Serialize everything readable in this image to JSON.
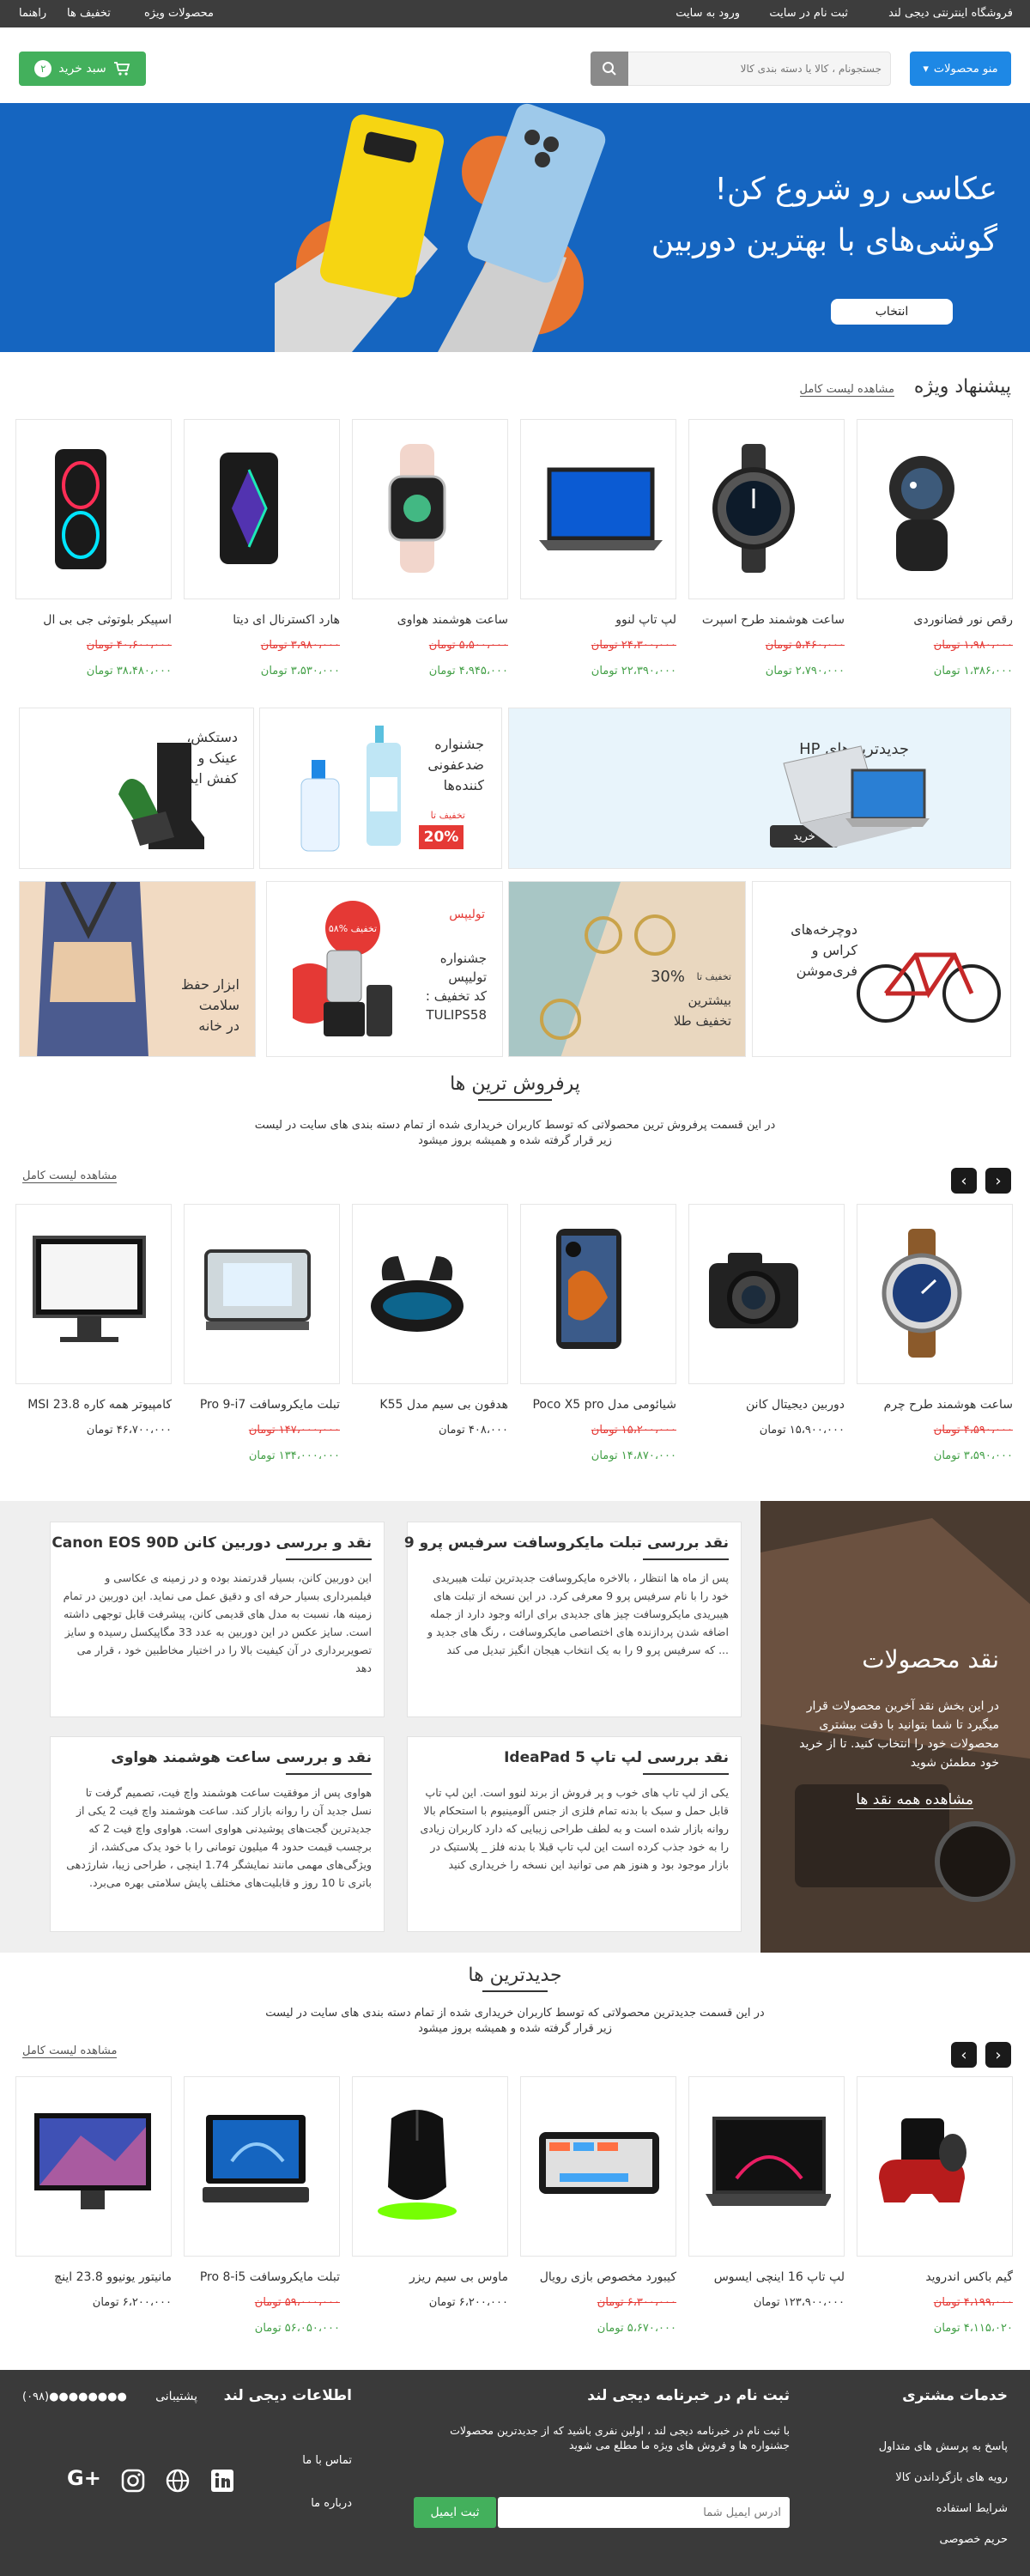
{
  "topbar": {
    "store_name": "فروشگاه اینترنتی دیجی لند",
    "register": "ثبت نام در سایت",
    "login": "ورود به سایت",
    "special": "محصولات ویژه",
    "discounts": "تخفیف ها",
    "help": "راهنما"
  },
  "header": {
    "menu_label": "منو محصولات",
    "search_placeholder": "جستجونام ، کالا یا دسته بندی کالا",
    "cart_label": "سبد خرید",
    "cart_count": "۲"
  },
  "hero": {
    "line1": "عکاسی رو شروع کن!",
    "line2": "گوشی‌های با بهترین دوربین",
    "button": "انتخاب"
  },
  "special": {
    "title": "پیشنهاد ویژه",
    "see_all": "مشاهده لیست کامل",
    "products": [
      {
        "name": "رقص نور فضانوردی",
        "old": "۱،۹۸۰،۰۰۰ تومان",
        "price": "۱،۳۸۶،۰۰۰ تومان",
        "icon": "astronaut-lamp-icon"
      },
      {
        "name": "ساعت هوشمند طرح اسپرت",
        "old": "۵،۴۶۰،۰۰۰ تومان",
        "price": "۲،۷۹۰،۰۰۰ تومان",
        "icon": "sport-smartwatch-icon"
      },
      {
        "name": "لپ تاپ لنوو",
        "old": "۲۴،۳۰۰،۰۰۰ تومان",
        "price": "۲۲،۳۹۰،۰۰۰ تومان",
        "icon": "laptop-icon"
      },
      {
        "name": "ساعت هوشمند هواوی",
        "old": "۵،۵۰۰،۰۰۰ تومان",
        "price": "۴،۹۴۵،۰۰۰ تومان",
        "icon": "huawei-watch-icon"
      },
      {
        "name": "هارد اکسترنال ای دیتا",
        "old": "۳،۹۸۰،۰۰۰ تومان",
        "price": "۳،۵۳۰،۰۰۰ تومان",
        "icon": "external-hdd-icon"
      },
      {
        "name": "اسپیکر بلوتوثی جی بی ال",
        "old": "۴۰،۶۰۰،۰۰۰ تومان",
        "price": "۳۸،۴۸۰،۰۰۰ تومان",
        "icon": "speaker-icon"
      }
    ]
  },
  "banners": {
    "hp": "جدیدترین‌های HP",
    "hp_btn": "خرید",
    "disinfect": "جشنواره\nضدعفونی\nکننده‌ها",
    "disinfect_tag": "تخفیف تا",
    "disinfect_pct": "20%",
    "safety": "دستکش،\nعینک و\nکفش ایمنی",
    "bike": "دوچرخه‌های\nکراس و\nفری‌موشن",
    "gold_small": "تخفیف تا",
    "gold_pct": "30%",
    "gold_text": "بیشترین\nتخفیف طلا",
    "tulips_brand": "تولیپس",
    "tulips_text": "جشنواره\nتولیپس\nکد تخفیف :\nTULIPS58",
    "tulips_sticker": "۵۸% تخفیف",
    "health": "ابزار حفظ\nسلامت\nدر خانه"
  },
  "bestsellers": {
    "title": "پرفروش ترین ها",
    "desc1": "در این قسمت پرفروش ترین محصولاتی که توسط کاربران خریداری شده از تمام دسته بندی های سایت در لیست",
    "desc2": "زیر قرار گرفته شده و همیشه بروز میشود",
    "see_all": "مشاهده لیست کامل",
    "prev": "‹",
    "next": "›",
    "products": [
      {
        "name": "ساعت هوشمند طرح چرم",
        "old": "۴،۵۹۰،۰۰۰ تومان",
        "price": "۳،۵۹۰،۰۰۰ تومان",
        "icon": "leather-watch-icon"
      },
      {
        "name": "دوربین دیجیتال کانن",
        "old": "",
        "price": "۱۵،۹۰۰،۰۰۰ تومان",
        "icon": "camera-icon"
      },
      {
        "name": "شیائومی مدل Poco X5 pro",
        "old": "۱۵،۲۰۰،۰۰۰ تومان",
        "price": "۱۴،۸۷۰،۰۰۰ تومان",
        "icon": "phone-icon"
      },
      {
        "name": "هدفون بی سیم مدل K55",
        "old": "",
        "price": "۴۰۸،۰۰۰ تومان",
        "icon": "earbuds-icon"
      },
      {
        "name": "تبلت مایکروسافت Pro 9-i7",
        "old": "۱۴۷،۰۰۰،۰۰۰ تومان",
        "price": "۱۳۴،۰۰۰،۰۰۰ تومان",
        "icon": "tablet-icon"
      },
      {
        "name": "کامپیوتر همه کاره MSI 23.8",
        "old": "",
        "price": "۴۶،۷۰۰،۰۰۰ تومان",
        "icon": "all-in-one-pc-icon"
      }
    ]
  },
  "reviews": {
    "hero_title": "نقد محصولات",
    "hero_text": "در این بخش نقد آخرین محصولات قرار میگیرد تا شما بتوانید با دقت بیشتری محصولات خود را انتخاب کنید. تا از خرید خود مطمئن شوید",
    "hero_link": "مشاهده همه نقد ها",
    "items": [
      {
        "title": "نقد بررسی تبلت مایکروسافت سرفیس پرو 9",
        "text": "پس از ماه ها انتظار ، بالاخره مایکروسافت جدیدترین تبلت هیبریدی خود را با نام سرفیس پرو 9 معرفی کرد. در این نسخه از تبلت های هیبریدی مایکروسافت چیز های جدیدی برای ارائه وجود دارد از جمله اضافه شدن پردازنده های اختصاصی مایکروسافت ، رنگ های جدید و ... که سرفیس پرو 9 را به یک انتخاب هیجان انگیز تبدیل می کند"
      },
      {
        "title": "نقد و بررسی دوربین کانن Canon EOS 90D",
        "text": "این دوربین کانن، بسیار قدرتمند بوده و در زمینه ی عکاسی و فیلمبرداری بسیار حرفه ای و دقیق عمل می نماید. این دوربین در تمام زمینه ها، نسبت به مدل های قدیمی کانن، پیشرفت قابل توجهی داشته است. سایز عکس در این دوربین به عدد 33 مگاپیکسل رسیده و سایز تصویربرداری در آن کیفیت بالا را در اختیار مخاطبین خود ، قرار می دهد"
      },
      {
        "title": "نقد بررسی لپ تاپ IdeaPad 5",
        "text": "یکی از لپ تاپ های خوب و پر فروش از برند لنوو است. این لپ تاپ قابل حمل و سبک با بدنه تمام فلزی از جنس آلومینیوم با استحکام بالا روانه بازار شده است و به لطف طراحی زیبایی که دارد کاربران زیادی را به خود جذب کرده است این لپ تاپ قبلا با بدنه فلز _ پلاستیک در بازار موجود بود و هنوز هم می توانید این نسخه را خریداری کنید"
      },
      {
        "title": "نقد و بررسی ساعت هوشمند هواوی",
        "text": "هواوی پس از موفقیت ساعت هوشمند واچ فیت، تصمیم گرفت تا نسل جدید آن را روانه بازار کند. ساعت هوشمند واچ فیت 2 یکی از جدیدترین گجت‌های پوشیدنی هواوی است. هواوی واچ فیت 2 که برچسب قیمت حدود 4 میلیون تومانی را با خود یدک می‌کشد، از ویژگی‌های مهمی مانند نمایشگر 1.74 اینچی ، طراحی زیبا، شارژدهی باتری تا 10 روز و قابلیت‌های مختلف پایش سلامتی بهره می‌برد."
      }
    ]
  },
  "newest": {
    "title": "جدیدترین ها",
    "desc1": "در این قسمت جدیدترین محصولاتی که توسط کاربران خریداری شده از تمام دسته بندی های سایت در لیست",
    "desc2": "زیر قرار گرفته شده و همیشه بروز میشود",
    "see_all": "مشاهده لیست کامل",
    "prev": "‹",
    "next": "›",
    "products": [
      {
        "name": "گیم باکس اندروید",
        "old": "۴،۱۹۹،۰۰۰ تومان",
        "price": "۴،۱۱۵،۰۲۰ تومان",
        "icon": "game-box-icon"
      },
      {
        "name": "لپ تاپ 16 اینچی ایسوس",
        "old": "",
        "price": "۱۲۳،۹۰۰،۰۰۰ تومان",
        "icon": "gaming-laptop-icon"
      },
      {
        "name": "کیبورد مخصوص بازی رویال",
        "old": "۶،۳۰۰،۰۰۰ تومان",
        "price": "۵،۶۷۰،۰۰۰ تومان",
        "icon": "keyboard-icon"
      },
      {
        "name": "ماوس بی سیم ریزر",
        "old": "",
        "price": "۶،۲۰۰،۰۰۰ تومان",
        "icon": "mouse-icon"
      },
      {
        "name": "تبلت مایکروسافت Pro 8-i5",
        "old": "۵۹،۰۰۰،۰۰۰ تومان",
        "price": "۵۶،۰۵۰،۰۰۰ تومان",
        "icon": "surface-tablet-icon"
      },
      {
        "name": "مانیتور یونیوو 23.8 اینچ",
        "old": "",
        "price": "۶،۲۰۰،۰۰۰ تومان",
        "icon": "monitor-icon"
      }
    ]
  },
  "footer": {
    "services_title": "خدمات مشتری",
    "services": [
      "پاسخ به پرسش های متداول",
      "رویه های بازگرداندن کالا",
      "شرایط استفاده",
      "حریم خصوصی"
    ],
    "newsletter_title": "ثبت نام در خبرنامه دیجی لند",
    "newsletter_text": "با ثبت نام در خبرنامه دیجی لند ، اولین نفری باشید که از جدیدترین محصولات جشنواره ها و فروش های ویژه ما مطلع می شوید",
    "email_placeholder": "آدرس ایمیل شما",
    "submit": "ثبت ایمیل",
    "info_title": "اطلاعات دیجی لند",
    "support": "پشتیبانی",
    "phone": "(۰۹۸)●●●●●●●●",
    "contact": "تماس با ما",
    "about": "درباره ما"
  }
}
